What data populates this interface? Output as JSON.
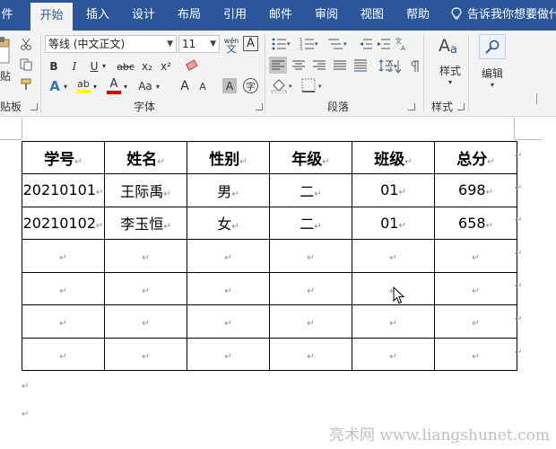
{
  "tabs": [
    {
      "label": "文件",
      "shown": "件"
    },
    {
      "label": "开始"
    },
    {
      "label": "插入"
    },
    {
      "label": "设计"
    },
    {
      "label": "布局"
    },
    {
      "label": "引用"
    },
    {
      "label": "邮件"
    },
    {
      "label": "审阅"
    },
    {
      "label": "视图"
    },
    {
      "label": "帮助"
    }
  ],
  "active_tab": "开始",
  "tell_me": "告诉我你想要做什",
  "ribbon": {
    "clipboard": {
      "paste_label": "贴",
      "group_label": "贴板"
    },
    "font": {
      "font_name": "等线 (中文正文)",
      "font_size": "11",
      "wen_top": "wén",
      "wen_bottom": "文",
      "border_char": "A",
      "bold": "B",
      "italic": "I",
      "underline": "U",
      "strike": "abc",
      "subscript": "x₂",
      "superscript": "x²",
      "text_effects": "A",
      "highlight": "ab",
      "font_color": "A",
      "change_case": "Aa",
      "grow": "A",
      "shrink": "A",
      "shading_char": "A",
      "enclose_char": "字",
      "group_label": "字体"
    },
    "paragraph": {
      "group_label": "段落"
    },
    "styles": {
      "label": "样式",
      "group_label": "样式"
    },
    "editing": {
      "label": "编辑"
    }
  },
  "table": {
    "headers": [
      "学号",
      "姓名",
      "性别",
      "年级",
      "班级",
      "总分"
    ],
    "rows": [
      [
        "20210101",
        "王际禹",
        "男",
        "二",
        "01",
        "698"
      ],
      [
        "20210102",
        "李玉恒",
        "女",
        "二",
        "01",
        "658"
      ],
      [
        "",
        "",
        "",
        "",
        "",
        ""
      ],
      [
        "",
        "",
        "",
        "",
        "",
        ""
      ],
      [
        "",
        "",
        "",
        "",
        "",
        ""
      ],
      [
        "",
        "",
        "",
        "",
        "",
        ""
      ]
    ],
    "end_mark": "↵"
  },
  "watermark": "亮术网 www.liangshunet.com",
  "colors": {
    "tab_bar": "#2b579a",
    "ribbon": "#f3f3f3",
    "font_color_bar": "#e00000",
    "highlight_bar": "#ffff00"
  }
}
